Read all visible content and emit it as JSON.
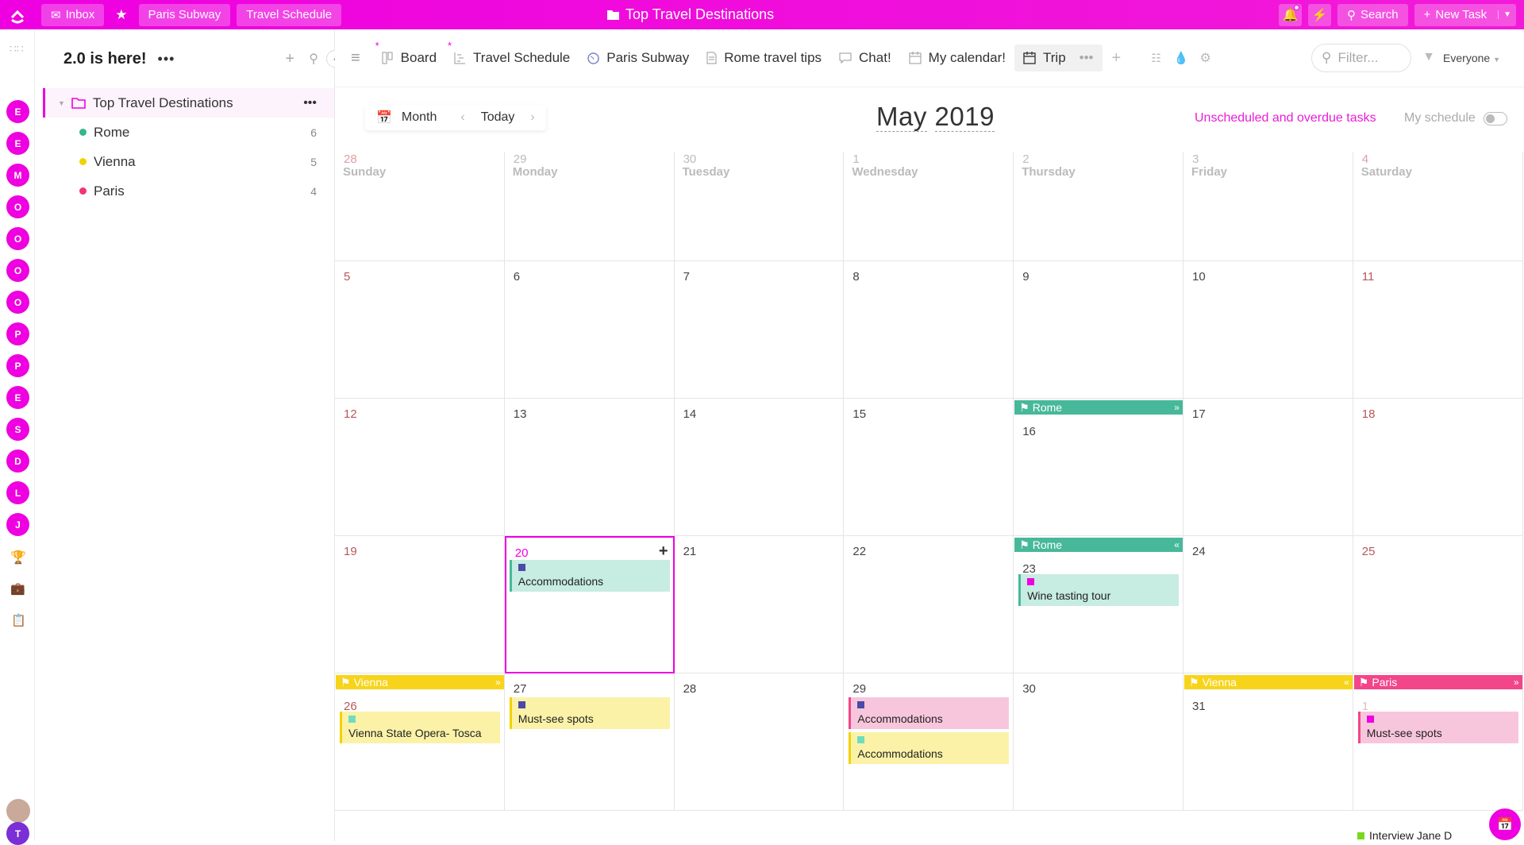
{
  "topbar": {
    "inbox": "Inbox",
    "crumb1": "Paris Subway",
    "crumb2": "Travel Schedule",
    "title": "Top Travel Destinations",
    "search": "Search",
    "new_task": "New Task"
  },
  "rail": {
    "avatars": [
      "E",
      "E",
      "M",
      "O",
      "O",
      "O",
      "O",
      "P",
      "P",
      "E",
      "S",
      "D",
      "L",
      "J"
    ],
    "bottom_avatar": "T"
  },
  "sidebar": {
    "title": "2.0 is here!",
    "folder": "Top Travel Destinations",
    "lists": [
      {
        "name": "Rome",
        "count": "6",
        "color": "#35b78a"
      },
      {
        "name": "Vienna",
        "count": "5",
        "color": "#f2d200"
      },
      {
        "name": "Paris",
        "count": "4",
        "color": "#f0357a"
      }
    ]
  },
  "tabs": {
    "items": [
      "Board",
      "Travel Schedule",
      "Paris Subway",
      "Rome travel tips",
      "Chat!",
      "My calendar!",
      "Trip"
    ],
    "filter_placeholder": "Filter...",
    "everyone": "Everyone"
  },
  "calendar": {
    "mode": "Month",
    "today": "Today",
    "month": "May",
    "year": "2019",
    "unscheduled": "Unscheduled and overdue tasks",
    "my_schedule": "My schedule",
    "day_names": [
      "Sunday",
      "Monday",
      "Tuesday",
      "Wednesday",
      "Thursday",
      "Friday",
      "Saturday"
    ],
    "weeks": [
      [
        "28",
        "29",
        "30",
        "1",
        "2",
        "3",
        "4"
      ],
      [
        "5",
        "6",
        "7",
        "8",
        "9",
        "10",
        "11"
      ],
      [
        "12",
        "13",
        "14",
        "15",
        "16",
        "17",
        "18"
      ],
      [
        "19",
        "20",
        "21",
        "22",
        "23",
        "24",
        "25"
      ],
      [
        "26",
        "27",
        "28",
        "29",
        "30",
        "31",
        "1"
      ]
    ],
    "spans": {
      "rome1": "Rome",
      "rome2": "Rome",
      "vienna1": "Vienna",
      "vienna2": "Vienna",
      "paris": "Paris"
    },
    "tasks": {
      "t1": "Accommodations",
      "t2": "Wine tasting tour",
      "t3": "Vienna State Opera- Tosca",
      "t4": "Must-see spots",
      "t5": "Accommodations",
      "t6": "Accommodations",
      "t7": "Must-see spots",
      "t8": "Interview Jane D"
    }
  },
  "colors": {
    "accent": "#ee00e0",
    "rome": "#47b99a",
    "vienna": "#f7d41a",
    "paris": "#f2458a"
  }
}
